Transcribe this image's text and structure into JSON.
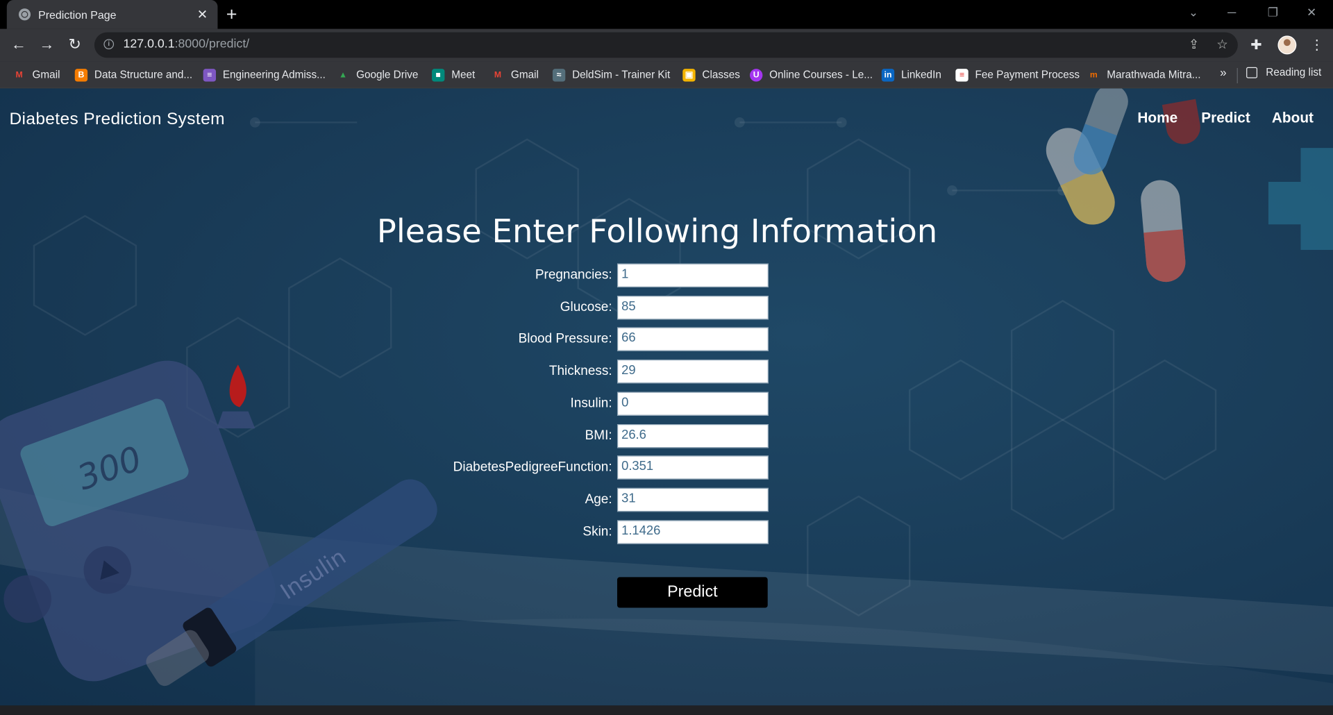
{
  "browser": {
    "tab_title": "Prediction Page",
    "tab_close": "✕",
    "new_tab": "+",
    "url_host": "127.0.0.1",
    "url_path": ":8000/predict/"
  },
  "bookmarks": [
    {
      "label": "Gmail",
      "icon": "gmail-icon",
      "color": "#ea4335"
    },
    {
      "label": "Data Structure and...",
      "icon": "blogger-icon",
      "color": "#f57c00"
    },
    {
      "label": "Engineering Admiss...",
      "icon": "list-icon",
      "color": "#7e57c2"
    },
    {
      "label": "Google Drive",
      "icon": "drive-icon",
      "color": "#34a853"
    },
    {
      "label": "Meet",
      "icon": "meet-icon",
      "color": "#00897b"
    },
    {
      "label": "Gmail",
      "icon": "gmail-icon",
      "color": "#ea4335"
    },
    {
      "label": "DeldSim - Trainer Kit",
      "icon": "deldsim-icon",
      "color": "#546e7a"
    },
    {
      "label": "Classes",
      "icon": "classroom-icon",
      "color": "#f4b400"
    },
    {
      "label": "Online Courses - Le...",
      "icon": "udemy-icon",
      "color": "#a435f0"
    },
    {
      "label": "LinkedIn",
      "icon": "linkedin-icon",
      "color": "#0a66c2"
    },
    {
      "label": "Fee Payment Process",
      "icon": "document-icon",
      "color": "#e53935"
    },
    {
      "label": "Marathwada Mitra...",
      "icon": "mm-icon",
      "color": "#ef6c00"
    }
  ],
  "reading_list": "Reading list",
  "bookmarks_more": "»",
  "site": {
    "brand": "Diabetes Prediction System",
    "nav": [
      "Home",
      "Predict",
      "About"
    ]
  },
  "form": {
    "heading": "Please Enter Following Information",
    "fields": [
      {
        "label": "Pregnancies:",
        "value": "1"
      },
      {
        "label": "Glucose:",
        "value": "85"
      },
      {
        "label": "Blood Pressure:",
        "value": "66"
      },
      {
        "label": "Thickness:",
        "value": "29"
      },
      {
        "label": "Insulin:",
        "value": "0"
      },
      {
        "label": "BMI:",
        "value": "26.6"
      },
      {
        "label": "DiabetesPedigreeFunction:",
        "value": "0.351"
      },
      {
        "label": "Age:",
        "value": "31"
      },
      {
        "label": "Skin:",
        "value": "1.1426"
      }
    ],
    "submit": "Predict"
  },
  "decor_text": {
    "meter_reading": "300",
    "pen_label": "Insulin"
  }
}
